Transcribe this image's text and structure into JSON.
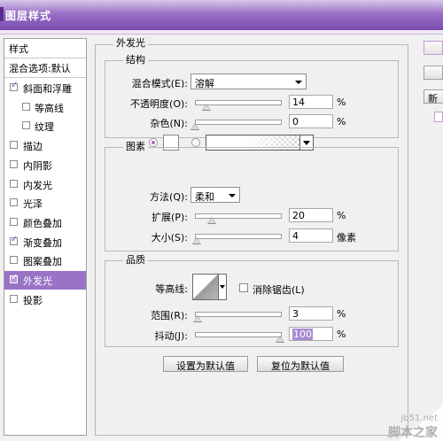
{
  "window": {
    "title": "图层样式"
  },
  "sidebar": {
    "header": "样式",
    "blend_options": "混合选项:默认",
    "items": [
      {
        "label": "斜面和浮雕",
        "checked": true,
        "indent": false
      },
      {
        "label": "等高线",
        "checked": false,
        "indent": true
      },
      {
        "label": "纹理",
        "checked": false,
        "indent": true
      },
      {
        "label": "描边",
        "checked": false,
        "indent": false
      },
      {
        "label": "内阴影",
        "checked": false,
        "indent": false
      },
      {
        "label": "内发光",
        "checked": false,
        "indent": false
      },
      {
        "label": "光泽",
        "checked": false,
        "indent": false
      },
      {
        "label": "颜色叠加",
        "checked": false,
        "indent": false
      },
      {
        "label": "渐变叠加",
        "checked": true,
        "indent": false
      },
      {
        "label": "图案叠加",
        "checked": false,
        "indent": false
      },
      {
        "label": "外发光",
        "checked": true,
        "indent": false,
        "selected": true
      },
      {
        "label": "投影",
        "checked": false,
        "indent": false
      }
    ]
  },
  "outer_glow": {
    "title": "外发光",
    "structure": {
      "title": "结构",
      "blend_mode_label": "混合模式(E):",
      "blend_mode_value": "溶解",
      "opacity_label": "不透明度(O):",
      "opacity_value": "14",
      "opacity_level": 0.14,
      "noise_label": "杂色(N):",
      "noise_value": "0",
      "noise_level": 0.0,
      "unit": "%"
    },
    "elements": {
      "title": "图素",
      "technique_label": "方法(Q):",
      "technique_value": "柔和",
      "spread_label": "扩展(P):",
      "spread_value": "20",
      "spread_level": 0.2,
      "size_label": "大小(S):",
      "size_value": "4",
      "size_level": 0.02,
      "unit_pct": "%",
      "unit_px": "像素"
    },
    "quality": {
      "title": "品质",
      "contour_label": "等高线:",
      "antialias_label": "消除锯齿(L)",
      "range_label": "范围(R):",
      "range_value": "3",
      "range_level": 0.03,
      "jitter_label": "抖动(J):",
      "jitter_value": "100",
      "jitter_level": 1.0,
      "unit": "%"
    },
    "buttons": {
      "make_default": "设置为默认值",
      "reset_default": "复位为默认值"
    }
  },
  "right": {
    "new_btn_partial": "新"
  },
  "watermark": {
    "line1": "jb51.net",
    "line2": "脚本之家"
  },
  "colors": {
    "accent": "#9a73c7",
    "title_bar": "#7a4cae",
    "radio_dot": "#c35fc5"
  }
}
